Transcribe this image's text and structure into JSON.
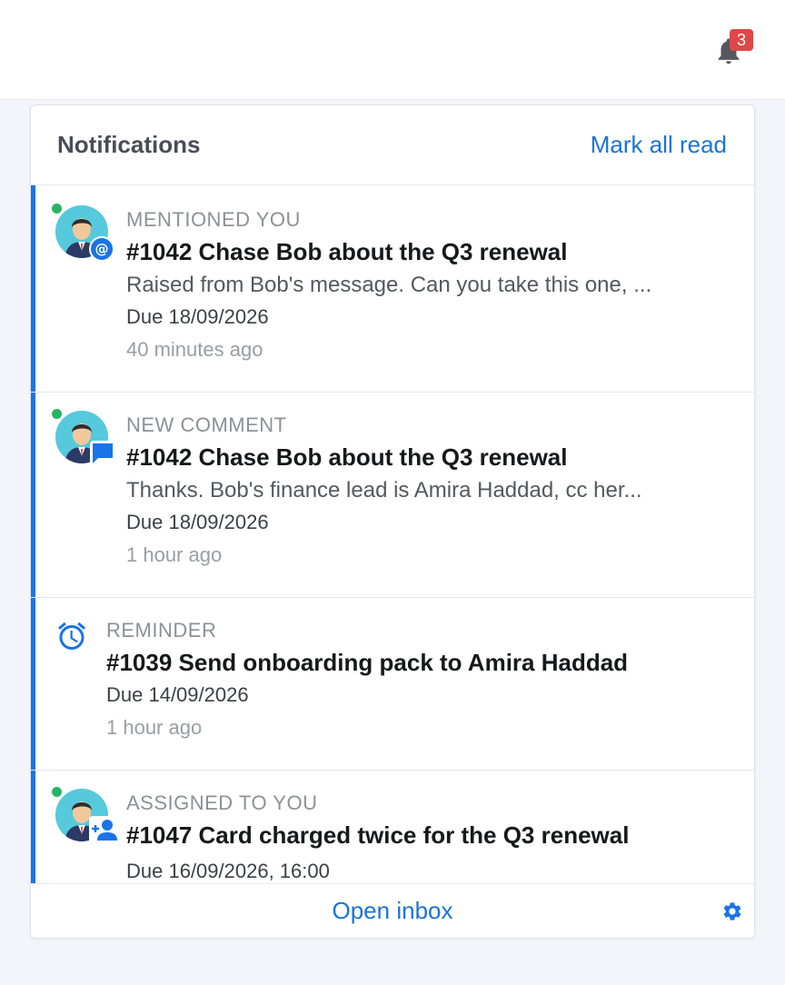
{
  "topbar": {
    "bell_icon": "bell-icon",
    "badge_count": "3",
    "badge_color": "#e04848"
  },
  "panel": {
    "title": "Notifications",
    "mark_all_read": "Mark all read",
    "footer": {
      "open_inbox": "Open inbox",
      "settings_icon": "gear-icon"
    }
  },
  "notifications": [
    {
      "kind": "MENTIONED YOU",
      "title": "#1042 Chase Bob about the Q3 renewal",
      "snippet": "Raised from Bob's message. Can you take this one, ...",
      "due": "Due 18/09/2026",
      "time": "40 minutes ago",
      "badge_icon": "at-mention-icon",
      "unread": true
    },
    {
      "kind": "NEW COMMENT",
      "title": "#1042 Chase Bob about the Q3 renewal",
      "snippet": "Thanks. Bob's finance lead is Amira Haddad, cc her...",
      "due": "Due 18/09/2026",
      "time": "1 hour ago",
      "badge_icon": "comment-icon",
      "unread": true
    },
    {
      "kind": "REMINDER",
      "title": "#1039 Send onboarding pack to Amira Haddad",
      "due": "Due 14/09/2026",
      "time": "1 hour ago",
      "badge_icon": "alarm-clock-icon",
      "unread": true
    },
    {
      "kind": "ASSIGNED TO YOU",
      "title": "#1047 Card charged twice for the Q3 renewal",
      "due": "Due 16/09/2026, 16:00",
      "badge_icon": "person-add-icon",
      "unread": true
    }
  ],
  "colors": {
    "accent": "#1a73d9",
    "unread_bar": "#1a73e8",
    "online": "#28b463"
  }
}
